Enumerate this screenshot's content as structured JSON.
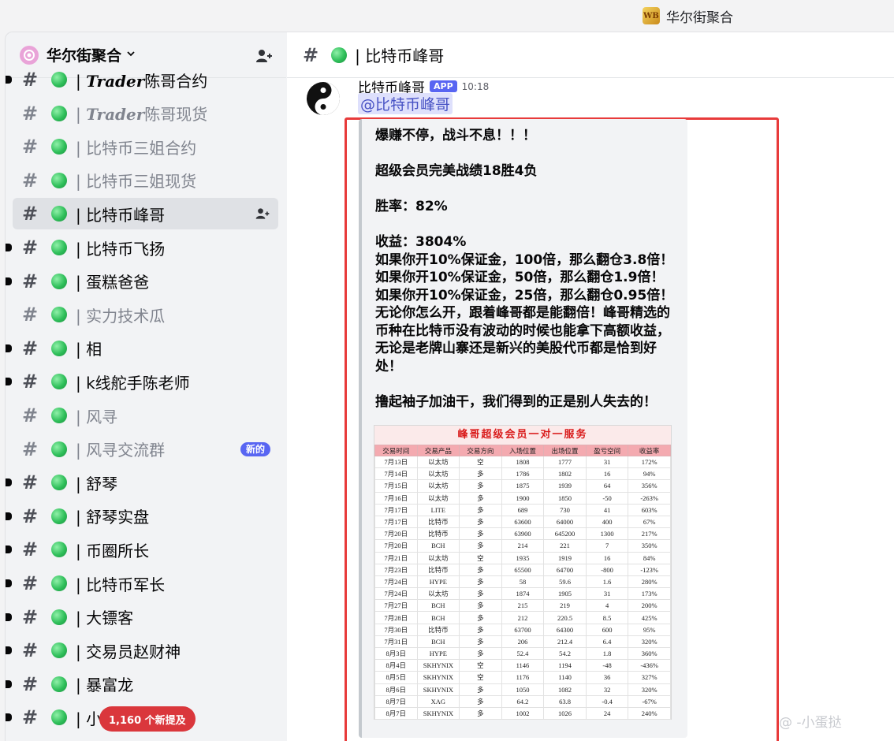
{
  "titlebar": {
    "app_name": "华尔街聚合",
    "app_logo_text": "WB"
  },
  "server": {
    "name": "华尔街聚合",
    "chevron": "⌄"
  },
  "channels": [
    {
      "name_prefix": "| ",
      "name_bold": "Trader",
      "name_rest": "陈哥合约",
      "unread": true,
      "muted": false
    },
    {
      "name_prefix": "| ",
      "name_bold": "Trader",
      "name_rest": "陈哥现货",
      "unread": false,
      "muted": true
    },
    {
      "name": "| 比特币三姐合约",
      "unread": false,
      "muted": true
    },
    {
      "name": "| 比特币三姐现货",
      "unread": false,
      "muted": true
    },
    {
      "name": "| 比特币峰哥",
      "unread": false,
      "muted": false,
      "active": true
    },
    {
      "name": "| 比特币飞扬",
      "unread": true,
      "muted": false
    },
    {
      "name": "| 蛋糕爸爸",
      "unread": true,
      "muted": false
    },
    {
      "name": "| 实力技术瓜",
      "unread": false,
      "muted": true
    },
    {
      "name": "| 相",
      "unread": true,
      "muted": false
    },
    {
      "name": "| k线舵手陈老师",
      "unread": true,
      "muted": false
    },
    {
      "name": "| 风寻",
      "unread": false,
      "muted": true
    },
    {
      "name": "| 风寻交流群",
      "unread": false,
      "muted": true,
      "badge": "新的"
    },
    {
      "name": "| 舒琴",
      "unread": true,
      "muted": false
    },
    {
      "name": "| 舒琴实盘",
      "unread": true,
      "muted": false
    },
    {
      "name": "| 币圈所长",
      "unread": true,
      "muted": false
    },
    {
      "name": "| 比特币军长",
      "unread": true,
      "muted": false
    },
    {
      "name": "| 大镖客",
      "unread": true,
      "muted": false
    },
    {
      "name": "| 交易员赵财神",
      "unread": true,
      "muted": false
    },
    {
      "name": "| 暴富龙",
      "unread": true,
      "muted": false
    },
    {
      "name": "| 小",
      "unread": true,
      "muted": false
    }
  ],
  "mention_pill": "1,160 个新提及",
  "channel_header": {
    "title": "| 比特币峰哥"
  },
  "message": {
    "author": "比特币峰哥",
    "tag": "APP",
    "time": "10:18",
    "mention": "@比特币峰哥",
    "lines": [
      "爆赚不停，战斗不息！！！",
      "",
      "超级会员完美战绩18胜4负",
      "",
      "胜率：82%",
      "",
      "收益：3804%",
      "如果你开10%保证金，100倍，那么翻仓3.8倍！",
      "如果你开10%保证金，50倍，那么翻仓1.9倍！",
      "如果你开10%保证金，25倍，那么翻仓0.95倍！",
      "无论你怎么开，跟着峰哥都是能翻倍！峰哥精选的币种在比特币没有波动的时候也能拿下高额收益，无论是老牌山寨还是新兴的美股代币都是恰到好处！",
      "",
      "撸起袖子加油干，我们得到的正是别人失去的！"
    ],
    "table": {
      "title": "峰哥超级会员一对一服务",
      "headers": [
        "交易时间",
        "交易产品",
        "交易方向",
        "入场位置",
        "出场位置",
        "盈亏空间",
        "收益率"
      ],
      "rows": [
        [
          "7月13日",
          "以太坊",
          "空",
          "1808",
          "1777",
          "31",
          "172%"
        ],
        [
          "7月14日",
          "以太坊",
          "多",
          "1786",
          "1802",
          "16",
          "94%"
        ],
        [
          "7月15日",
          "以太坊",
          "多",
          "1875",
          "1939",
          "64",
          "356%"
        ],
        [
          "7月16日",
          "以太坊",
          "多",
          "1900",
          "1850",
          "-50",
          "-263%"
        ],
        [
          "7月17日",
          "LITE",
          "多",
          "689",
          "730",
          "41",
          "603%"
        ],
        [
          "7月17日",
          "比特币",
          "多",
          "63600",
          "64000",
          "400",
          "67%"
        ],
        [
          "7月20日",
          "比特币",
          "多",
          "63900",
          "645200",
          "1300",
          "217%"
        ],
        [
          "7月20日",
          "BCH",
          "多",
          "214",
          "221",
          "7",
          "350%"
        ],
        [
          "7月21日",
          "以太坊",
          "空",
          "1935",
          "1919",
          "16",
          "84%"
        ],
        [
          "7月23日",
          "比特币",
          "多",
          "65500",
          "64700",
          "-800",
          "-123%"
        ],
        [
          "7月24日",
          "HYPE",
          "多",
          "58",
          "59.6",
          "1.6",
          "280%"
        ],
        [
          "7月24日",
          "以太坊",
          "多",
          "1874",
          "1905",
          "31",
          "173%"
        ],
        [
          "7月27日",
          "BCH",
          "多",
          "215",
          "219",
          "4",
          "200%"
        ],
        [
          "7月28日",
          "BCH",
          "多",
          "212",
          "220.5",
          "8.5",
          "425%"
        ],
        [
          "7月30日",
          "比特币",
          "多",
          "63700",
          "64300",
          "600",
          "95%"
        ],
        [
          "7月31日",
          "BCH",
          "多",
          "206",
          "212.4",
          "6.4",
          "320%"
        ],
        [
          "8月3日",
          "HYPE",
          "多",
          "52.4",
          "54.2",
          "1.8",
          "360%"
        ],
        [
          "8月4日",
          "SKHYNIX",
          "空",
          "1146",
          "1194",
          "-48",
          "-436%"
        ],
        [
          "8月5日",
          "SKHYNIX",
          "空",
          "1176",
          "1140",
          "36",
          "327%"
        ],
        [
          "8月6日",
          "SKHYNIX",
          "多",
          "1050",
          "1082",
          "32",
          "320%"
        ],
        [
          "8月7日",
          "XAG",
          "多",
          "64.2",
          "63.8",
          "-0.4",
          "-67%"
        ],
        [
          "8月7日",
          "SKHYNIX",
          "多",
          "1002",
          "1026",
          "24",
          "240%"
        ]
      ]
    }
  },
  "watermark": "@ -小蛋挞",
  "colors": {
    "accent": "#5865f2",
    "highlight_frame": "#e83b3b",
    "mention_pill": "#da373c"
  }
}
